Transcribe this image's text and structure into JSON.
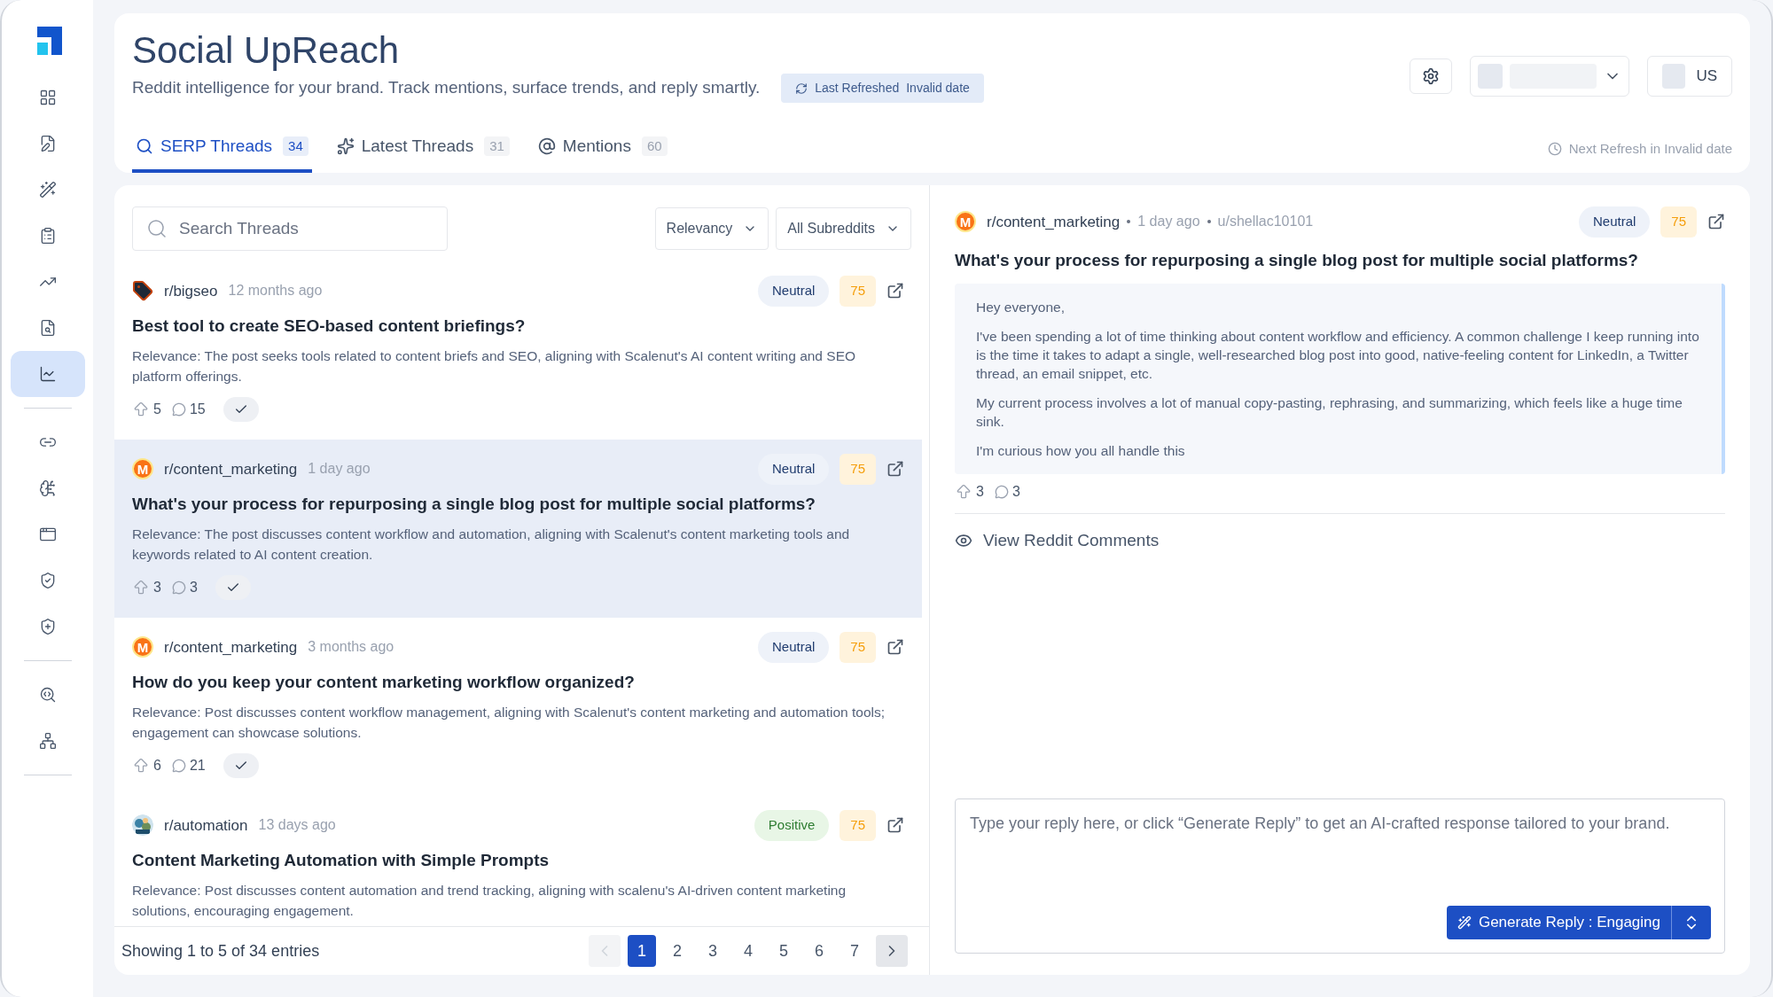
{
  "sidebar": {
    "groups": [
      [
        {
          "selected": false
        },
        {
          "selected": false
        },
        {
          "selected": false
        },
        {
          "selected": false
        },
        {
          "selected": false
        },
        {
          "selected": false
        },
        {
          "selected": true
        }
      ],
      [
        {
          "selected": false
        },
        {
          "selected": false
        },
        {
          "selected": false
        },
        {
          "selected": false
        },
        {
          "selected": false
        }
      ],
      [
        {
          "selected": false
        },
        {
          "selected": false
        }
      ]
    ]
  },
  "header": {
    "title": "Social UpReach",
    "subtitle": "Reddit intelligence for your brand. Track mentions, surface trends, and reply smartly.",
    "refresh_label": "Last Refreshed",
    "refresh_value": "Invalid date",
    "country": "US",
    "next_refresh": "Next Refresh in Invalid date"
  },
  "tabs": [
    {
      "label": "SERP Threads",
      "count": "34",
      "selected": true
    },
    {
      "label": "Latest Threads",
      "count": "31",
      "selected": false
    },
    {
      "label": "Mentions",
      "count": "60",
      "selected": false
    }
  ],
  "search": {
    "placeholder": "Search Threads"
  },
  "filters": [
    "Relevancy",
    "All Subreddits"
  ],
  "threads": [
    {
      "avatar": {
        "kind": "tag"
      },
      "subreddit": "r/bigseo",
      "time": "12 months ago",
      "sentiment": {
        "label": "Neutral",
        "kind": "neutral"
      },
      "score": "75",
      "title": "Best tool to create SEO-based content briefings?",
      "relevance": "Relevance: The post seeks tools related to content briefs and SEO, aligning with Scalenut's AI content writing and SEO platform offerings.",
      "upvotes": "5",
      "comments": "15",
      "selected": false
    },
    {
      "avatar": {
        "kind": "letter",
        "text": "M"
      },
      "subreddit": "r/content_marketing",
      "time": "1 day ago",
      "sentiment": {
        "label": "Neutral",
        "kind": "neutral"
      },
      "score": "75",
      "title": "What's your process for repurposing a single blog post for multiple social platforms?",
      "relevance": "Relevance: The post discusses content workflow and automation, aligning with Scalenut's content marketing tools and keywords related to AI content creation.",
      "upvotes": "3",
      "comments": "3",
      "selected": true
    },
    {
      "avatar": {
        "kind": "letter",
        "text": "M"
      },
      "subreddit": "r/content_marketing",
      "time": "3 months ago",
      "sentiment": {
        "label": "Neutral",
        "kind": "neutral"
      },
      "score": "75",
      "title": "How do you keep your content marketing workflow organized?",
      "relevance": "Relevance: Post discusses content workflow management, aligning with Scalenut's content marketing and automation tools; engagement can showcase solutions.",
      "upvotes": "6",
      "comments": "21",
      "selected": false
    },
    {
      "subreddit": "r/automation",
      "time": "13 days ago",
      "sentiment": {
        "label": "Positive",
        "kind": "positive"
      },
      "score": "75",
      "title": "Content Marketing Automation with Simple Prompts",
      "relevance": "Relevance: Post discusses content automation and trend tracking, aligning with scalenu's AI-driven content marketing solutions, encouraging engagement.",
      "selected": false
    }
  ],
  "pagination": {
    "summary": "Showing 1 to 5 of 34 entries",
    "prev_disabled": true,
    "pages": [
      {
        "label": "1",
        "selected": true
      },
      {
        "label": "2",
        "selected": false
      },
      {
        "label": "3",
        "selected": false
      },
      {
        "label": "4",
        "selected": false
      },
      {
        "label": "5",
        "selected": false
      },
      {
        "label": "6",
        "selected": false
      },
      {
        "label": "7",
        "selected": false
      }
    ]
  },
  "detail": {
    "avatar": {
      "kind": "letter",
      "text": "M"
    },
    "subreddit": "r/content_marketing",
    "time": "1 day ago",
    "author": "u/shellac10101",
    "sentiment": {
      "label": "Neutral",
      "kind": "neutral"
    },
    "score": "75",
    "title": "What's your process for repurposing a single blog post for multiple social platforms?",
    "body": [
      "Hey everyone,",
      "I've been spending a lot of time thinking about content workflow and efficiency. A common challenge I keep running into is the time it takes to adapt a single, well-researched blog post into good, native-feeling content for LinkedIn, a Twitter thread, an email snippet, etc.",
      "My current process involves a lot of manual copy-pasting, rephrasing, and summarizing, which feels like a huge time sink.",
      "I'm curious how you all handle this"
    ],
    "upvotes": "3",
    "comments": "3",
    "view_comments": "View Reddit Comments"
  },
  "reply": {
    "placeholder": "Type your reply here, or click “Generate Reply” to get an AI-crafted response tailored to your brand.",
    "generate_label": "Generate Reply : Engaging"
  }
}
